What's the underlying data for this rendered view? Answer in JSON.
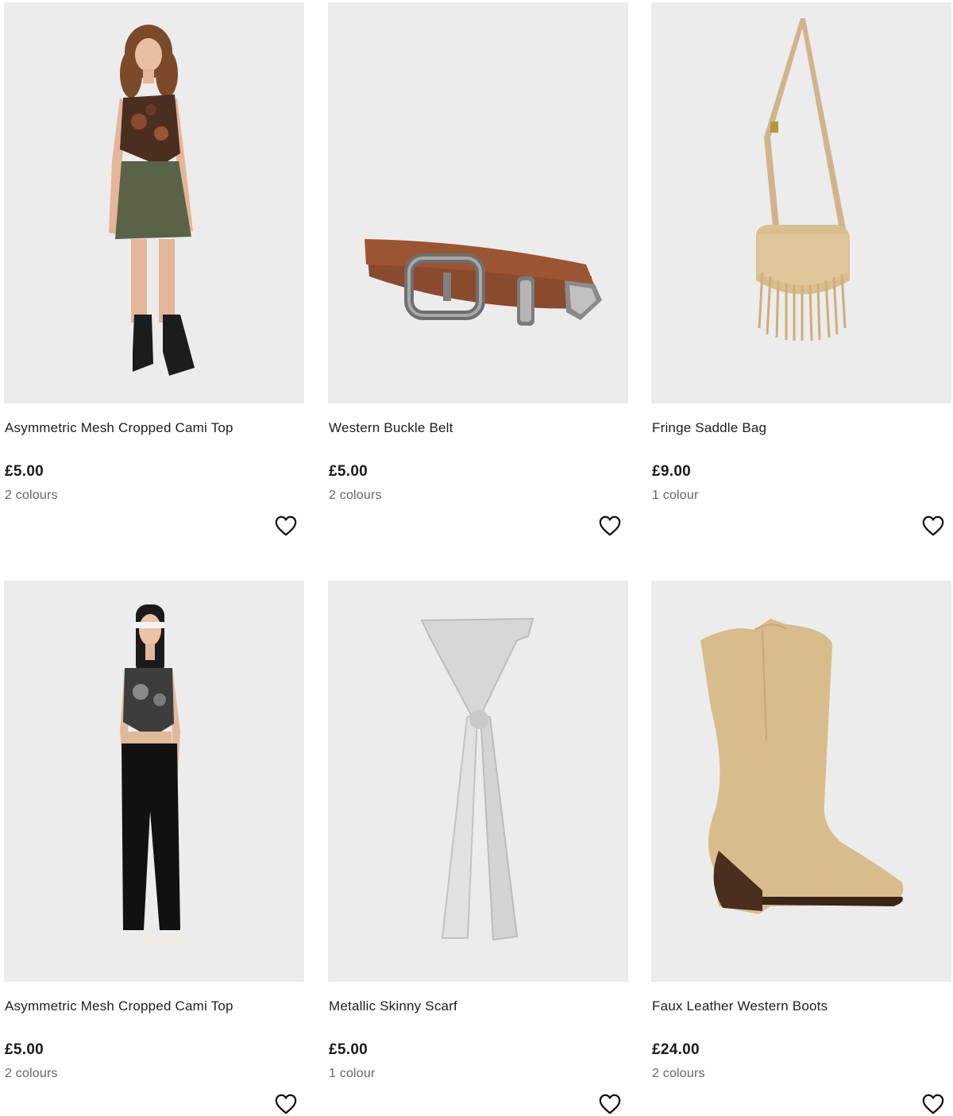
{
  "products": [
    {
      "title": "Asymmetric Mesh Cropped Cami Top",
      "price": "£5.00",
      "colours": "2 colours",
      "image_icon": "model-cami-skirt-image",
      "wishlist_icon": "heart-outline-icon"
    },
    {
      "title": "Western Buckle Belt",
      "price": "£5.00",
      "colours": "2 colours",
      "image_icon": "brown-belt-image",
      "wishlist_icon": "heart-outline-icon"
    },
    {
      "title": "Fringe Saddle Bag",
      "price": "£9.00",
      "colours": "1 colour",
      "image_icon": "fringe-bag-image",
      "wishlist_icon": "heart-outline-icon"
    },
    {
      "title": "Asymmetric Mesh Cropped Cami Top",
      "price": "£5.00",
      "colours": "2 colours",
      "image_icon": "model-cami-trousers-image",
      "wishlist_icon": "heart-outline-icon"
    },
    {
      "title": "Metallic Skinny Scarf",
      "price": "£5.00",
      "colours": "1 colour",
      "image_icon": "silver-scarf-image",
      "wishlist_icon": "heart-outline-icon"
    },
    {
      "title": "Faux Leather Western Boots",
      "price": "£24.00",
      "colours": "2 colours",
      "image_icon": "western-boot-image",
      "wishlist_icon": "heart-outline-icon"
    }
  ],
  "colors": {
    "image_bg": "#ececec",
    "text": "#1e1e1e",
    "muted": "#666666"
  }
}
